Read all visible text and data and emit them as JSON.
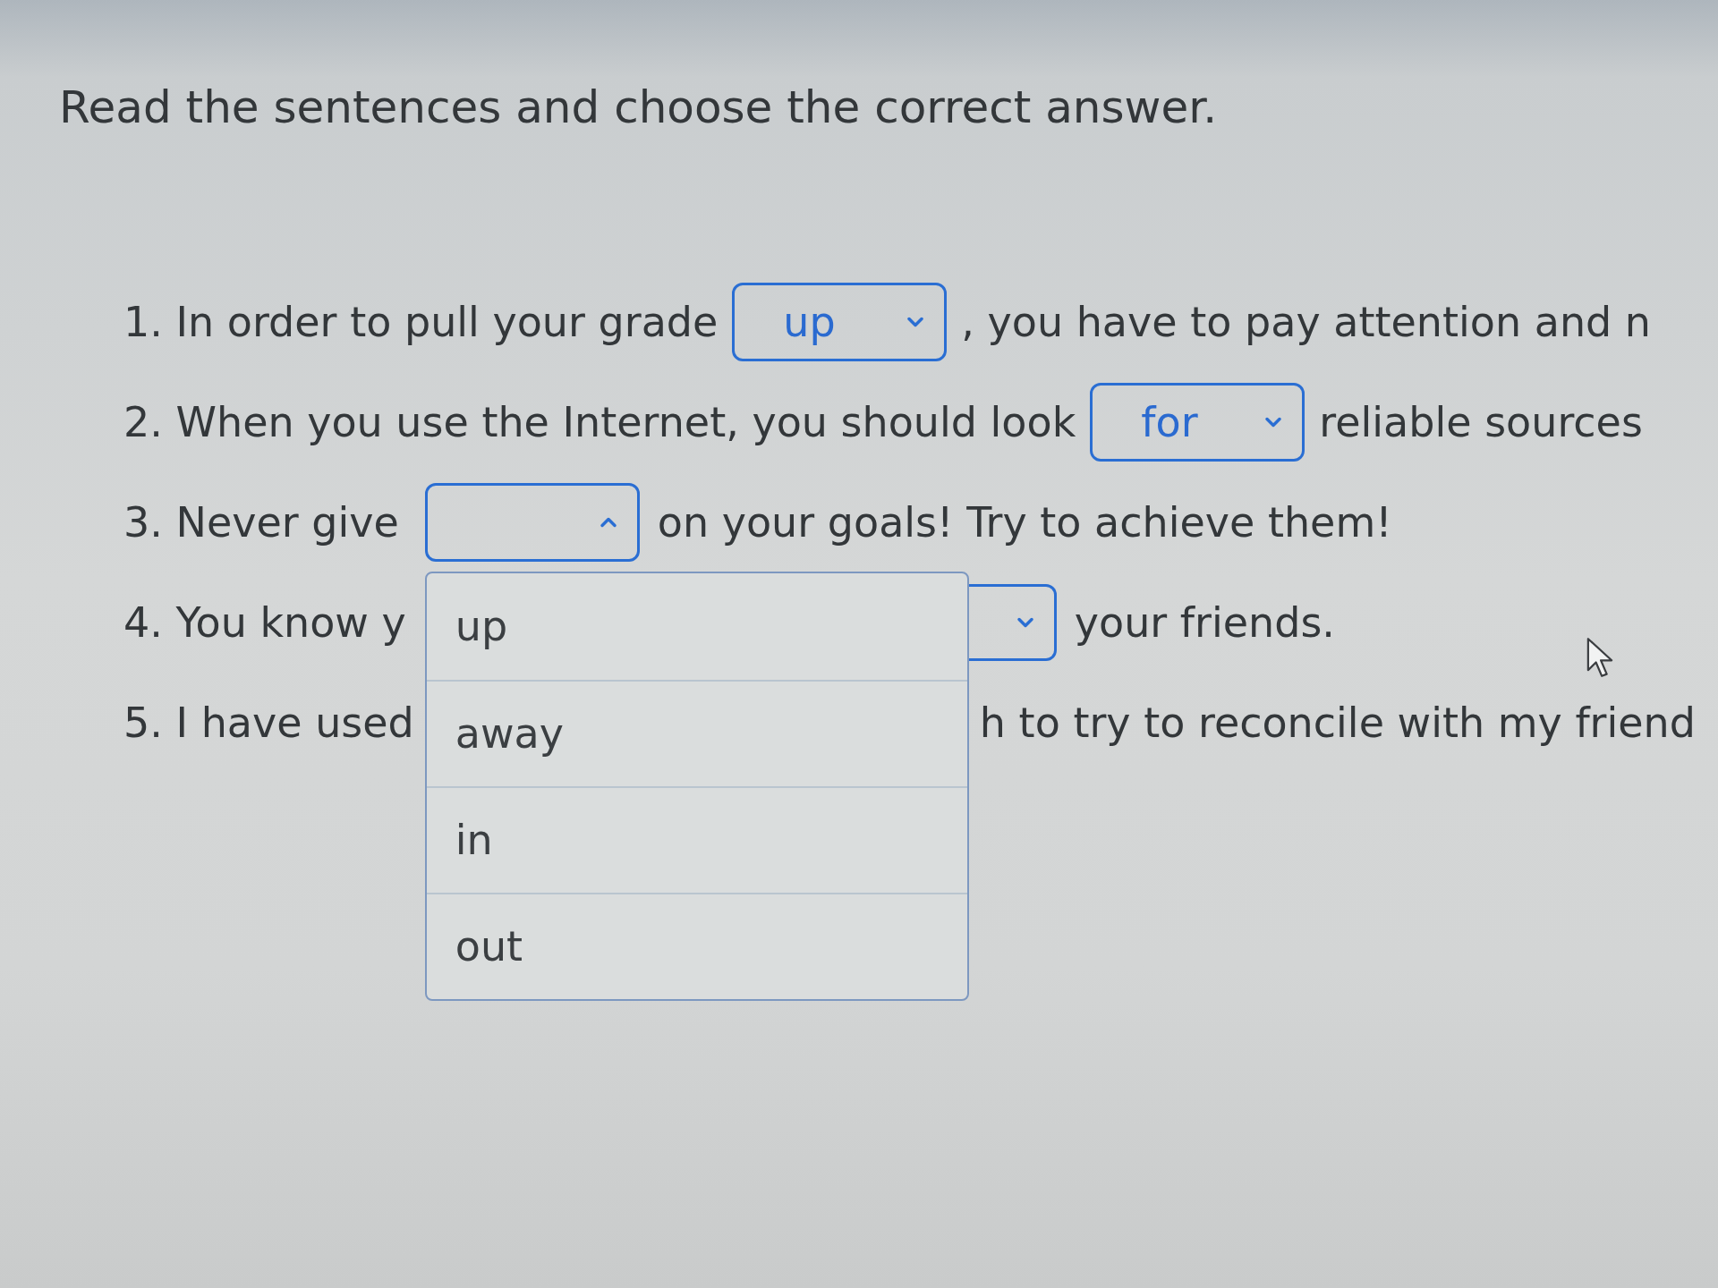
{
  "instructions": "Read the sentences and choose the correct answer.",
  "sentences": [
    {
      "parts": [
        {
          "kind": "text",
          "text": "1. In order to pull your grade"
        },
        {
          "kind": "dropdown",
          "value": "up",
          "expanded": false
        },
        {
          "kind": "text",
          "text": ", you have to pay attention and n"
        }
      ]
    },
    {
      "parts": [
        {
          "kind": "text",
          "text": "2. When you use the Internet, you should look"
        },
        {
          "kind": "dropdown",
          "value": "for",
          "expanded": false
        },
        {
          "kind": "text",
          "text": "reliable sources"
        }
      ]
    },
    {
      "parts": [
        {
          "kind": "text",
          "text": "3. Never give"
        },
        {
          "kind": "dropdown",
          "expanded": true,
          "options": [
            {
              "text": "up",
              "selected": false
            },
            {
              "text": "away",
              "selected": false
            },
            {
              "text": "in",
              "selected": false
            },
            {
              "text": "out",
              "selected": false
            }
          ]
        },
        {
          "kind": "text",
          "text": "on your goals! Try to achieve them!"
        }
      ]
    },
    {
      "parts": [
        {
          "kind": "text",
          "text": "4. You know y"
        },
        {
          "kind": "dropdown",
          "expanded": false
        },
        {
          "kind": "text",
          "text": "your friends."
        }
      ]
    },
    {
      "parts": [
        {
          "kind": "text",
          "text": "5. I have used"
        },
        {
          "kind": "text",
          "text": "h to try to reconcile with my friend"
        }
      ]
    }
  ]
}
